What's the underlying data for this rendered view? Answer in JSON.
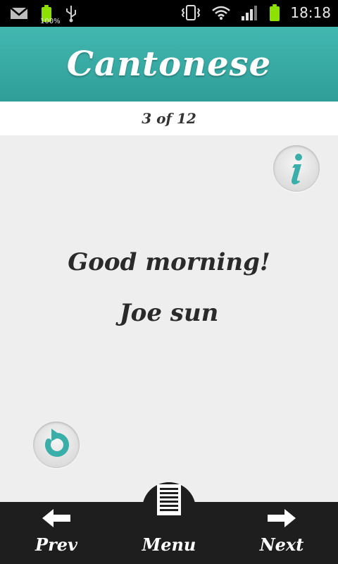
{
  "statusbar": {
    "battery_percent": "100%",
    "time": "18:18"
  },
  "header": {
    "title": "Cantonese"
  },
  "counter": {
    "text": "3 of 12"
  },
  "card": {
    "english": "Good morning!",
    "cantonese": "Joe sun"
  },
  "bottom_nav": {
    "prev_label": "Prev",
    "menu_label": "Menu",
    "next_label": "Next"
  },
  "colors": {
    "accent": "#3aaea8",
    "header_dark": "#2f9e98",
    "card_bg": "#eeeeee",
    "bottombar_bg": "#1e1e1e"
  },
  "icons": [
    "gmail-icon",
    "battery-icon",
    "usb-icon",
    "vibrate-icon",
    "wifi-icon",
    "signal-icon",
    "battery-icon",
    "info-icon",
    "reset-icon",
    "left-arrow-icon",
    "menu-list-icon",
    "right-arrow-icon"
  ]
}
